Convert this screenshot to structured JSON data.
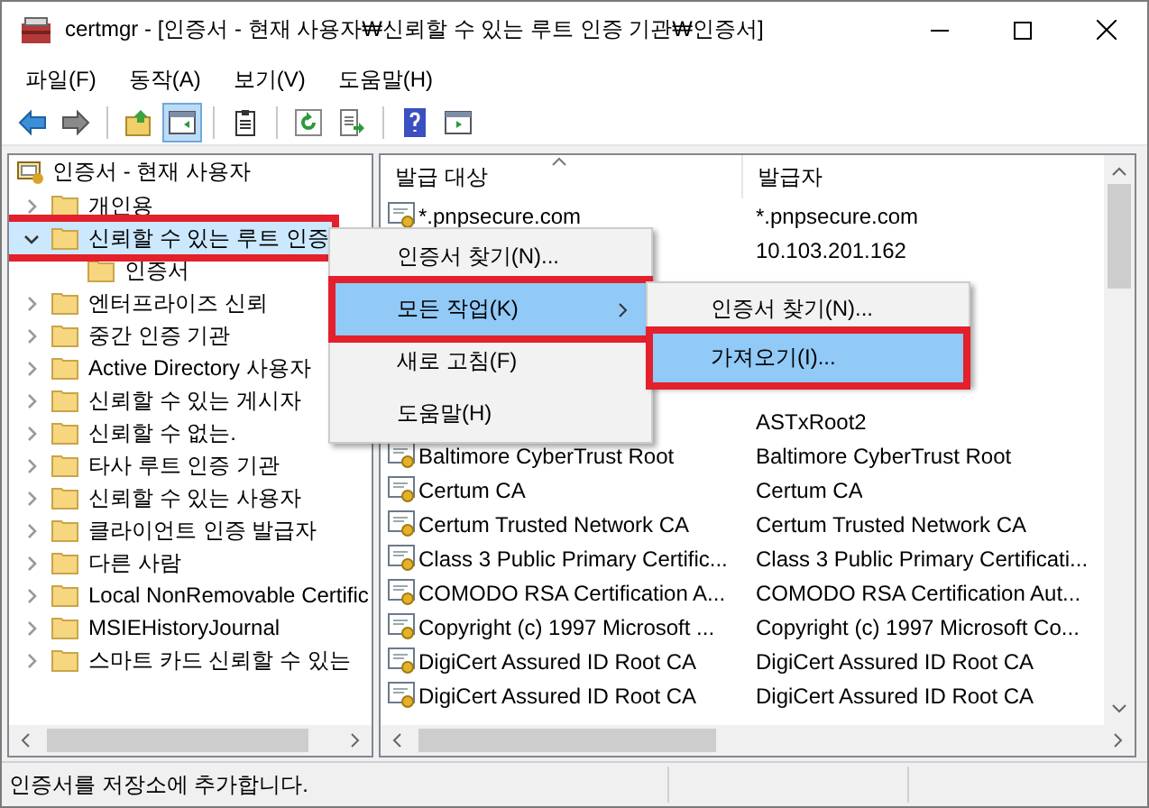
{
  "window": {
    "title": "certmgr - [인증서 - 현재 사용자₩신뢰할 수 있는 루트 인증 기관₩인증서]"
  },
  "menu_bar": [
    "파일(F)",
    "동작(A)",
    "보기(V)",
    "도움말(H)"
  ],
  "toolbar": [
    [
      {
        "kind": "back",
        "pressed": false
      },
      {
        "kind": "forward",
        "pressed": false
      }
    ],
    [
      {
        "kind": "up",
        "pressed": false
      },
      {
        "kind": "tree",
        "pressed": true
      }
    ],
    [
      {
        "kind": "properties",
        "pressed": false
      }
    ],
    [
      {
        "kind": "refresh",
        "pressed": false
      },
      {
        "kind": "export",
        "pressed": false
      }
    ],
    [
      {
        "kind": "help",
        "pressed": false
      },
      {
        "kind": "pane",
        "pressed": false
      }
    ]
  ],
  "tree": {
    "root": "인증서 - 현재 사용자",
    "children": [
      {
        "label": "개인용",
        "expanded": false,
        "selected": false,
        "highlighted": false
      },
      {
        "label": "신뢰할 수 있는 루트 인증",
        "expanded": true,
        "selected": true,
        "highlighted": true,
        "children": [
          {
            "label": "인증서",
            "selected": false,
            "highlighted": false
          }
        ]
      },
      {
        "label": "엔터프라이즈 신뢰",
        "expanded": false,
        "selected": false,
        "highlighted": false
      },
      {
        "label": "중간 인증 기관",
        "expanded": false,
        "selected": false,
        "highlighted": false
      },
      {
        "label": "Active Directory 사용자",
        "expanded": false,
        "selected": false,
        "highlighted": false
      },
      {
        "label": "신뢰할 수 있는 게시자",
        "expanded": false,
        "selected": false,
        "highlighted": false
      },
      {
        "label": "신뢰할 수 없는.",
        "expanded": false,
        "selected": false,
        "highlighted": false
      },
      {
        "label": "타사 루트 인증 기관",
        "expanded": false,
        "selected": false,
        "highlighted": false
      },
      {
        "label": "신뢰할 수 있는 사용자",
        "expanded": false,
        "selected": false,
        "highlighted": false
      },
      {
        "label": "클라이언트 인증 발급자",
        "expanded": false,
        "selected": false,
        "highlighted": false
      },
      {
        "label": "다른 사람",
        "expanded": false,
        "selected": false,
        "highlighted": false
      },
      {
        "label": "Local NonRemovable Certific",
        "expanded": false,
        "selected": false,
        "highlighted": false
      },
      {
        "label": "MSIEHistoryJournal",
        "expanded": false,
        "selected": false,
        "highlighted": false
      },
      {
        "label": "스마트 카드 신뢰할 수 있는",
        "expanded": false,
        "selected": false,
        "highlighted": false
      }
    ]
  },
  "list": {
    "columns": [
      "발급 대상",
      "발급자"
    ],
    "rows": [
      {
        "issued_to": "*.pnpsecure.com",
        "issued_by": "*.pnpsecure.com"
      },
      {
        "issued_by": "10.103.201.162"
      },
      {},
      {},
      {},
      {},
      {
        "issued_by": "ASTxRoot2"
      },
      {
        "issued_to": "Baltimore CyberTrust Root",
        "issued_by": "Baltimore CyberTrust Root"
      },
      {
        "issued_to": "Certum CA",
        "issued_by": "Certum CA"
      },
      {
        "issued_to": "Certum Trusted Network CA",
        "issued_by": "Certum Trusted Network CA"
      },
      {
        "issued_to": "Class 3 Public Primary Certific...",
        "issued_by": "Class 3 Public Primary Certificati..."
      },
      {
        "issued_to": "COMODO RSA Certification A...",
        "issued_by": "COMODO RSA Certification Aut..."
      },
      {
        "issued_to": "Copyright (c) 1997 Microsoft ...",
        "issued_by": "Copyright (c) 1997 Microsoft Co..."
      },
      {
        "issued_to": "DigiCert Assured ID Root CA",
        "issued_by": "DigiCert Assured ID Root CA"
      },
      {
        "issued_to": "DigiCert Assured ID Root CA",
        "issued_by": "DigiCert Assured ID Root CA"
      }
    ]
  },
  "context_menu": {
    "items": [
      {
        "label": "인증서 찾기(N)...",
        "selected": false,
        "submenu": false,
        "highlighted": false
      },
      {
        "label": "모든 작업(K)",
        "selected": true,
        "submenu": true,
        "highlighted": true
      },
      {
        "label": "새로 고침(F)",
        "selected": false,
        "submenu": false,
        "highlighted": false
      },
      {
        "label": "도움말(H)",
        "selected": false,
        "submenu": false,
        "highlighted": false
      }
    ]
  },
  "submenu": {
    "items": [
      {
        "label": "인증서 찾기(N)...",
        "selected": false,
        "highlighted": false
      },
      {
        "label": "가져오기(I)...",
        "selected": true,
        "highlighted": true
      }
    ]
  },
  "status_bar": "인증서를 저장소에 추가합니다."
}
